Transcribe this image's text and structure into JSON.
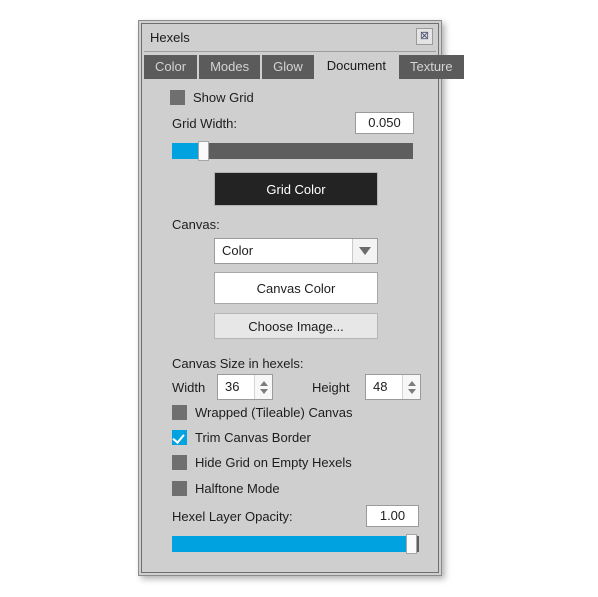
{
  "window": {
    "title": "Hexels",
    "close_icon": "close-icon",
    "close_glyph": "⊠"
  },
  "tabs": [
    {
      "label": "Color",
      "active": false
    },
    {
      "label": "Modes",
      "active": false
    },
    {
      "label": "Glow",
      "active": false
    },
    {
      "label": "Document",
      "active": true
    },
    {
      "label": "Texture",
      "active": false
    }
  ],
  "document_tab": {
    "show_grid": {
      "label": "Show Grid",
      "checked": false
    },
    "grid_width": {
      "label": "Grid Width:",
      "value": "0.050",
      "slider_percent": 13
    },
    "grid_color_button": {
      "label": "Grid Color",
      "color": "#232323"
    },
    "canvas_section": {
      "label": "Canvas:",
      "dropdown_value": "Color",
      "dropdown_options": [
        "Color"
      ],
      "canvas_color_button": "Canvas Color",
      "choose_image_button": "Choose Image..."
    },
    "canvas_size": {
      "label": "Canvas Size in hexels:",
      "width_label": "Width",
      "width_value": "36",
      "height_label": "Height",
      "height_value": "48"
    },
    "options": [
      {
        "label": "Wrapped (Tileable) Canvas",
        "checked": false
      },
      {
        "label": "Trim Canvas Border",
        "checked": true
      },
      {
        "label": "Hide Grid on Empty Hexels",
        "checked": false
      },
      {
        "label": "Halftone Mode",
        "checked": false
      }
    ],
    "hexel_layer_opacity": {
      "label": "Hexel Layer Opacity:",
      "value": "1.00",
      "slider_percent": 100
    }
  },
  "colors": {
    "accent": "#00a2e0",
    "panel": "#cfcfcf",
    "tab_inactive": "#5b5b5b",
    "checkbox_off": "#6f6f6f",
    "slider_track": "#5e5e5e"
  }
}
